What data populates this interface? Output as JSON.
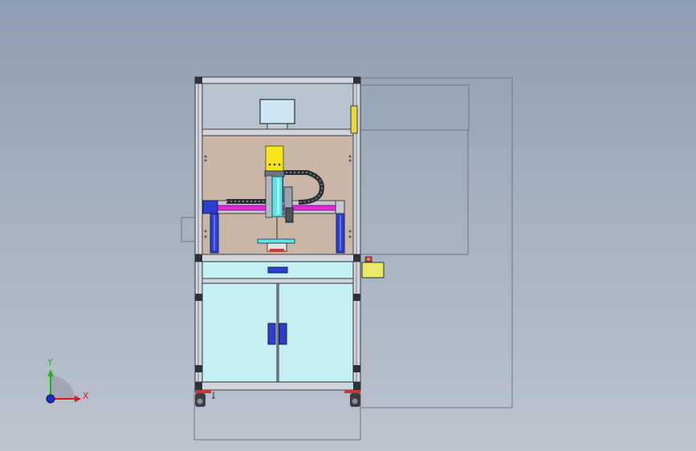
{
  "viewport": {
    "background_top": "#8e9fb3",
    "background_bottom": "#bcc4cf"
  },
  "triad": {
    "x_label": "X",
    "y_label": "Y",
    "x_color": "#e0141e",
    "y_color": "#1fb21f",
    "z_color": "#1e2bd0"
  },
  "colors": {
    "frame": "#d2d6dc",
    "frame_edge": "#3a3d42",
    "back_panel": "#c9b6a6",
    "glass": "#c4f0f4",
    "linear_rail": "#e02ad8",
    "guard_blue": "#2a3fd0",
    "head_yellow": "#f4e41c",
    "module_cyan": "#5de3e8",
    "control_box": "#eaea6a",
    "monitor": "#cde6f6"
  }
}
